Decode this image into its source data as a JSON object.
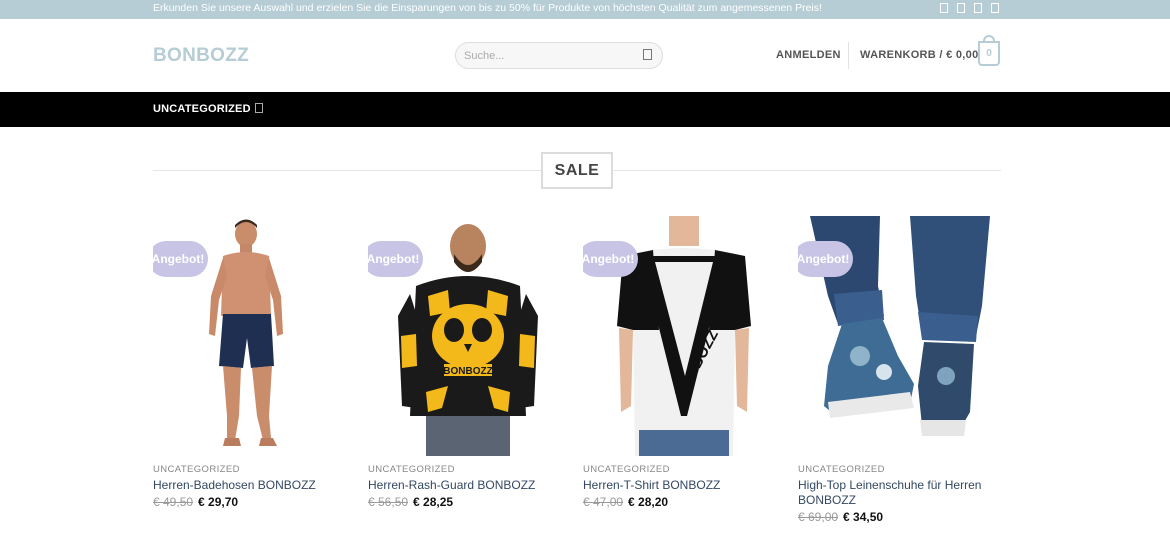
{
  "topbar": {
    "message": "Erkunden Sie unsere Auswahl und erzielen Sie die Einsparungen von bis zu 50% für Produkte von höchsten Qualität zum angemessenen Preis!",
    "icons": [
      "social-icon",
      "social-icon",
      "social-icon",
      "social-icon"
    ]
  },
  "header": {
    "logo": "BONBOZZ",
    "search_placeholder": "Suche...",
    "login_label": "ANMELDEN",
    "cart_label": "WARENKORB / € 0,00",
    "cart_count": "0"
  },
  "nav": {
    "items": [
      {
        "label": "UNCATEGORIZED",
        "has_dropdown": true
      }
    ]
  },
  "section": {
    "title": "SALE"
  },
  "products": [
    {
      "badge": "Angebot!",
      "category": "UNCATEGORIZED",
      "name": "Herren-Badehosen BONBOZZ",
      "old_price": "€ 49,50",
      "new_price": "€ 29,70"
    },
    {
      "badge": "Angebot!",
      "category": "UNCATEGORIZED",
      "name": "Herren-Rash-Guard BONBOZZ",
      "old_price": "€ 56,50",
      "new_price": "€ 28,25"
    },
    {
      "badge": "Angebot!",
      "category": "UNCATEGORIZED",
      "name": "Herren-T-Shirt BONBOZZ",
      "old_price": "€ 47,00",
      "new_price": "€ 28,20"
    },
    {
      "badge": "Angebot!",
      "category": "UNCATEGORIZED",
      "name": "High-Top Leinenschuhe für Herren BONBOZZ",
      "old_price": "€ 69,00",
      "new_price": "€ 34,50"
    }
  ],
  "product_image_text": {
    "print": "BONBOZZ"
  },
  "colors": {
    "accent": "#b6cdd5",
    "badge": "#c7c4e6",
    "nav_bg": "#000000",
    "link": "#334862"
  }
}
